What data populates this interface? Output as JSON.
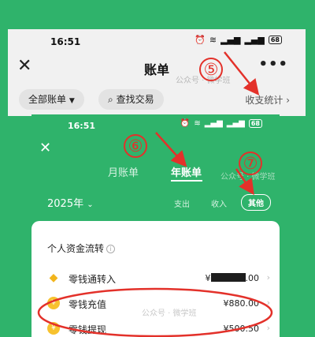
{
  "screen1": {
    "status_time": "16:51",
    "battery": "68",
    "title": "账单",
    "filter_all": "全部账单",
    "search_label": "查找交易",
    "stats_label": "收支统计",
    "watermark": "公众号 · 微学班",
    "icons": [
      "alarm-icon",
      "wifi-icon",
      "signal-icon",
      "battery-icon",
      "close-icon",
      "more-icon",
      "chevron-down-icon",
      "search-icon",
      "chevron-right-icon"
    ]
  },
  "screen2": {
    "status_time": "16:51",
    "battery": "68",
    "tabs": [
      {
        "label": "月账单"
      },
      {
        "label": "年账单"
      }
    ],
    "year": "2025年",
    "filters": [
      {
        "label": "支出"
      },
      {
        "label": "收入"
      },
      {
        "label": "其他"
      }
    ],
    "card_title": "个人资金流转",
    "rows": [
      {
        "label": "零钱通转入",
        "amount_prefix": "¥",
        "amount_suffix": ".00"
      },
      {
        "label": "零钱充值",
        "amount": "¥880.00"
      },
      {
        "label": "零钱提现",
        "amount": "¥500.50"
      }
    ],
    "watermark_top": "公众号 · 微学班",
    "watermark_bottom": "公众号 · 微学班"
  },
  "annotations": {
    "step5": "⑤",
    "step6": "⑥",
    "step7": "⑦",
    "color": "#e3312a"
  },
  "colors": {
    "background_green": "#2fb36b",
    "annotation_red": "#e3312a"
  }
}
